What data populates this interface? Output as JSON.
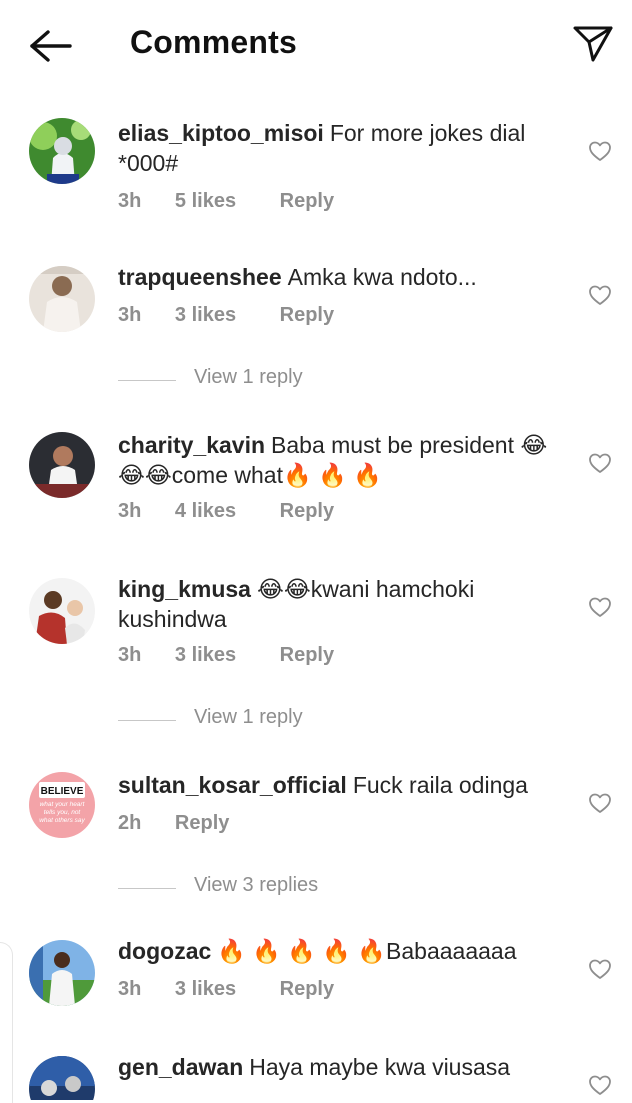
{
  "header": {
    "title": "Comments",
    "back_icon": "arrow-left-icon",
    "send_icon": "paper-plane-icon"
  },
  "comments": [
    {
      "username": "elias_kiptoo_misoi",
      "text": "For more jokes dial *000#",
      "time": "3h",
      "likes": "5 likes",
      "reply": "Reply"
    },
    {
      "username": "trapqueenshee",
      "text": "Amka kwa ndoto...",
      "time": "3h",
      "likes": "3 likes",
      "reply": "Reply",
      "view_replies": "View 1 reply"
    },
    {
      "username": "charity_kavin",
      "text": "Baba must be president 😂😂😂come what🔥 🔥 🔥",
      "time": "3h",
      "likes": "4 likes",
      "reply": "Reply"
    },
    {
      "username": "king_kmusa",
      "text": "😂😂kwani hamchoki kushindwa",
      "time": "3h",
      "likes": "3 likes",
      "reply": "Reply",
      "view_replies": "View 1 reply"
    },
    {
      "username": "sultan_kosar_official",
      "text": "Fuck raila odinga",
      "time": "2h",
      "reply": "Reply",
      "view_replies": "View 3 replies",
      "avatar_text": [
        "BELIEVE",
        "what your heart",
        "tells you, not",
        "what others say"
      ]
    },
    {
      "username": "dogozac",
      "text": "🔥 🔥 🔥 🔥 🔥Babaaaaaaa",
      "time": "3h",
      "likes": "3 likes",
      "reply": "Reply"
    },
    {
      "username": "gen_dawan",
      "text": "Haya maybe kwa viusasa"
    }
  ],
  "colors": {
    "text": "#262626",
    "muted": "#8e8e8e",
    "divider": "#c7c7c7",
    "avatar_text_red": "#c0392b"
  }
}
